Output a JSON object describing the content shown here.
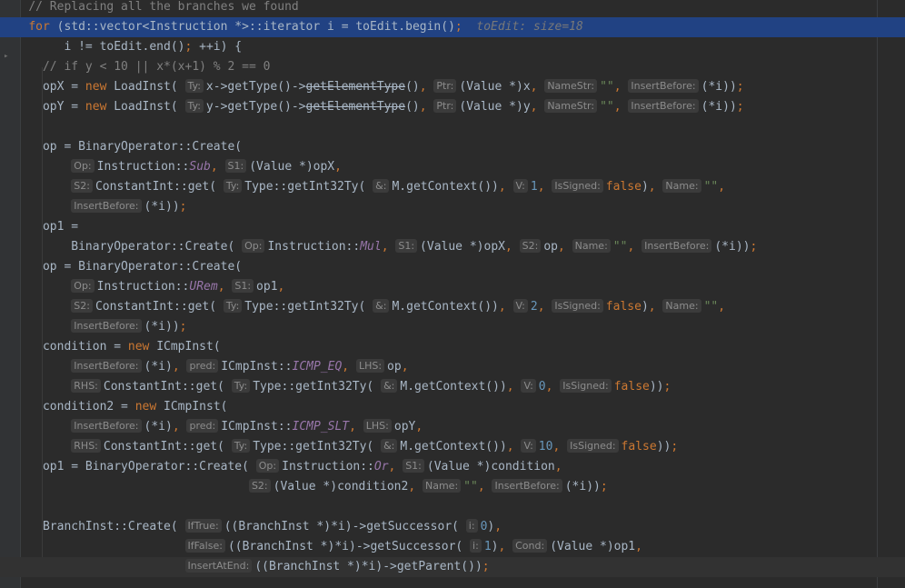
{
  "editor": {
    "lines": [
      [
        {
          "t": "    "
        },
        {
          "t": "// Replacing all the branches we found",
          "c": "c"
        }
      ],
      [
        {
          "t": "    "
        },
        {
          "t": "for",
          "c": "k"
        },
        {
          "t": " (std::vector<Instruction *>::iterator i = toEdit.begin()"
        },
        {
          "t": ";",
          "c": "k"
        },
        {
          "t": "  "
        },
        {
          "t": "toEdit: size=18",
          "c": "dbg"
        }
      ],
      [
        {
          "t": "         i != toEdit.end()"
        },
        {
          "t": ";",
          "c": "k"
        },
        {
          "t": " ++i) {"
        }
      ],
      [
        {
          "t": "      "
        },
        {
          "t": "// if y < 10 || x*(x+1) % 2 == 0",
          "c": "c"
        }
      ],
      [
        {
          "t": "      opX = "
        },
        {
          "t": "new",
          "c": "k"
        },
        {
          "t": " LoadInst( "
        },
        {
          "h": "Ty:"
        },
        {
          "t": "x->getType()->"
        },
        {
          "t": "getElementType",
          "c": "dep"
        },
        {
          "t": "()"
        },
        {
          "t": ", ",
          "c": "k"
        },
        {
          "h": "Ptr:"
        },
        {
          "t": "(Value *)x"
        },
        {
          "t": ", ",
          "c": "k"
        },
        {
          "h": "NameStr:"
        },
        {
          "t": "\"\"",
          "c": "s"
        },
        {
          "t": ", ",
          "c": "k"
        },
        {
          "h": "InsertBefore:"
        },
        {
          "t": "(*i))"
        },
        {
          "t": ";",
          "c": "k"
        }
      ],
      [
        {
          "t": "      opY = "
        },
        {
          "t": "new",
          "c": "k"
        },
        {
          "t": " LoadInst( "
        },
        {
          "h": "Ty:"
        },
        {
          "t": "y->getType()->"
        },
        {
          "t": "getElementType",
          "c": "dep"
        },
        {
          "t": "()"
        },
        {
          "t": ", ",
          "c": "k"
        },
        {
          "h": "Ptr:"
        },
        {
          "t": "(Value *)y"
        },
        {
          "t": ", ",
          "c": "k"
        },
        {
          "h": "NameStr:"
        },
        {
          "t": "\"\"",
          "c": "s"
        },
        {
          "t": ", ",
          "c": "k"
        },
        {
          "h": "InsertBefore:"
        },
        {
          "t": "(*i))"
        },
        {
          "t": ";",
          "c": "k"
        }
      ],
      [],
      [
        {
          "t": "      op = BinaryOperator::Create("
        }
      ],
      [
        {
          "t": "          "
        },
        {
          "h": "Op:"
        },
        {
          "t": "Instruction::"
        },
        {
          "t": "Sub",
          "c": "em"
        },
        {
          "t": ", ",
          "c": "k"
        },
        {
          "h": "S1:"
        },
        {
          "t": "(Value *)opX"
        },
        {
          "t": ",",
          "c": "k"
        }
      ],
      [
        {
          "t": "          "
        },
        {
          "h": "S2:"
        },
        {
          "t": "ConstantInt::get( "
        },
        {
          "h": "Ty:"
        },
        {
          "t": "Type::getInt32Ty( "
        },
        {
          "h": "&:"
        },
        {
          "t": "M.getContext())"
        },
        {
          "t": ", ",
          "c": "k"
        },
        {
          "h": "V:"
        },
        {
          "t": "1",
          "c": "n"
        },
        {
          "t": ", ",
          "c": "k"
        },
        {
          "h": "IsSigned:"
        },
        {
          "t": "false",
          "c": "k"
        },
        {
          "t": ")"
        },
        {
          "t": ", ",
          "c": "k"
        },
        {
          "h": "Name:"
        },
        {
          "t": "\"\"",
          "c": "s"
        },
        {
          "t": ",",
          "c": "k"
        }
      ],
      [
        {
          "t": "          "
        },
        {
          "h": "InsertBefore:"
        },
        {
          "t": "(*i))"
        },
        {
          "t": ";",
          "c": "k"
        }
      ],
      [
        {
          "t": "      op1 ="
        }
      ],
      [
        {
          "t": "          BinaryOperator::Create( "
        },
        {
          "h": "Op:"
        },
        {
          "t": "Instruction::"
        },
        {
          "t": "Mul",
          "c": "em"
        },
        {
          "t": ", ",
          "c": "k"
        },
        {
          "h": "S1:"
        },
        {
          "t": "(Value *)opX"
        },
        {
          "t": ", ",
          "c": "k"
        },
        {
          "h": "S2:"
        },
        {
          "t": "op"
        },
        {
          "t": ", ",
          "c": "k"
        },
        {
          "h": "Name:"
        },
        {
          "t": "\"\"",
          "c": "s"
        },
        {
          "t": ", ",
          "c": "k"
        },
        {
          "h": "InsertBefore:"
        },
        {
          "t": "(*i))"
        },
        {
          "t": ";",
          "c": "k"
        }
      ],
      [
        {
          "t": "      op = BinaryOperator::Create("
        }
      ],
      [
        {
          "t": "          "
        },
        {
          "h": "Op:"
        },
        {
          "t": "Instruction::"
        },
        {
          "t": "URem",
          "c": "em"
        },
        {
          "t": ", ",
          "c": "k"
        },
        {
          "h": "S1:"
        },
        {
          "t": "op1"
        },
        {
          "t": ",",
          "c": "k"
        }
      ],
      [
        {
          "t": "          "
        },
        {
          "h": "S2:"
        },
        {
          "t": "ConstantInt::get( "
        },
        {
          "h": "Ty:"
        },
        {
          "t": "Type::getInt32Ty( "
        },
        {
          "h": "&:"
        },
        {
          "t": "M.getContext())"
        },
        {
          "t": ", ",
          "c": "k"
        },
        {
          "h": "V:"
        },
        {
          "t": "2",
          "c": "n"
        },
        {
          "t": ", ",
          "c": "k"
        },
        {
          "h": "IsSigned:"
        },
        {
          "t": "false",
          "c": "k"
        },
        {
          "t": ")"
        },
        {
          "t": ", ",
          "c": "k"
        },
        {
          "h": "Name:"
        },
        {
          "t": "\"\"",
          "c": "s"
        },
        {
          "t": ",",
          "c": "k"
        }
      ],
      [
        {
          "t": "          "
        },
        {
          "h": "InsertBefore:"
        },
        {
          "t": "(*i))"
        },
        {
          "t": ";",
          "c": "k"
        }
      ],
      [
        {
          "t": "      condition = "
        },
        {
          "t": "new",
          "c": "k"
        },
        {
          "t": " ICmpInst("
        }
      ],
      [
        {
          "t": "          "
        },
        {
          "h": "InsertBefore:"
        },
        {
          "t": "(*i)"
        },
        {
          "t": ", ",
          "c": "k"
        },
        {
          "h": "pred:"
        },
        {
          "t": "ICmpInst::"
        },
        {
          "t": "ICMP_EQ",
          "c": "em"
        },
        {
          "t": ", ",
          "c": "k"
        },
        {
          "h": "LHS:"
        },
        {
          "t": "op"
        },
        {
          "t": ",",
          "c": "k"
        }
      ],
      [
        {
          "t": "          "
        },
        {
          "h": "RHS:"
        },
        {
          "t": "ConstantInt::get( "
        },
        {
          "h": "Ty:"
        },
        {
          "t": "Type::getInt32Ty( "
        },
        {
          "h": "&:"
        },
        {
          "t": "M.getContext())"
        },
        {
          "t": ", ",
          "c": "k"
        },
        {
          "h": "V:"
        },
        {
          "t": "0",
          "c": "n"
        },
        {
          "t": ", ",
          "c": "k"
        },
        {
          "h": "IsSigned:"
        },
        {
          "t": "false",
          "c": "k"
        },
        {
          "t": "))"
        },
        {
          "t": ";",
          "c": "k"
        }
      ],
      [
        {
          "t": "      condition2 = "
        },
        {
          "t": "new",
          "c": "k"
        },
        {
          "t": " ICmpInst("
        }
      ],
      [
        {
          "t": "          "
        },
        {
          "h": "InsertBefore:"
        },
        {
          "t": "(*i)"
        },
        {
          "t": ", ",
          "c": "k"
        },
        {
          "h": "pred:"
        },
        {
          "t": "ICmpInst::"
        },
        {
          "t": "ICMP_SLT",
          "c": "em"
        },
        {
          "t": ", ",
          "c": "k"
        },
        {
          "h": "LHS:"
        },
        {
          "t": "opY"
        },
        {
          "t": ",",
          "c": "k"
        }
      ],
      [
        {
          "t": "          "
        },
        {
          "h": "RHS:"
        },
        {
          "t": "ConstantInt::get( "
        },
        {
          "h": "Ty:"
        },
        {
          "t": "Type::getInt32Ty( "
        },
        {
          "h": "&:"
        },
        {
          "t": "M.getContext())"
        },
        {
          "t": ", ",
          "c": "k"
        },
        {
          "h": "V:"
        },
        {
          "t": "10",
          "c": "n"
        },
        {
          "t": ", ",
          "c": "k"
        },
        {
          "h": "IsSigned:"
        },
        {
          "t": "false",
          "c": "k"
        },
        {
          "t": "))"
        },
        {
          "t": ";",
          "c": "k"
        }
      ],
      [
        {
          "t": "      op1 = BinaryOperator::Create( "
        },
        {
          "h": "Op:"
        },
        {
          "t": "Instruction::"
        },
        {
          "t": "Or",
          "c": "em"
        },
        {
          "t": ", ",
          "c": "k"
        },
        {
          "h": "S1:"
        },
        {
          "t": "(Value *)condition"
        },
        {
          "t": ",",
          "c": "k"
        }
      ],
      [
        {
          "t": "                                   "
        },
        {
          "h": "S2:"
        },
        {
          "t": "(Value *)condition2"
        },
        {
          "t": ", ",
          "c": "k"
        },
        {
          "h": "Name:"
        },
        {
          "t": "\"\"",
          "c": "s"
        },
        {
          "t": ", ",
          "c": "k"
        },
        {
          "h": "InsertBefore:"
        },
        {
          "t": "(*i))"
        },
        {
          "t": ";",
          "c": "k"
        }
      ],
      [],
      [
        {
          "t": "      BranchInst::Create( "
        },
        {
          "h": "IfTrue:"
        },
        {
          "t": "((BranchInst *)*i)->getSuccessor( "
        },
        {
          "h": "i:"
        },
        {
          "t": "0",
          "c": "n"
        },
        {
          "t": ")"
        },
        {
          "t": ",",
          "c": "k"
        }
      ],
      [
        {
          "t": "                          "
        },
        {
          "h": "IfFalse:"
        },
        {
          "t": "((BranchInst *)*i)->getSuccessor( "
        },
        {
          "h": "i:"
        },
        {
          "t": "1",
          "c": "n"
        },
        {
          "t": ")"
        },
        {
          "t": ", ",
          "c": "k"
        },
        {
          "h": "Cond:"
        },
        {
          "t": "(Value *)op1"
        },
        {
          "t": ",",
          "c": "k"
        }
      ],
      [
        {
          "t": "                          "
        },
        {
          "h": "InsertAtEnd:"
        },
        {
          "t": "((BranchInst *)*i)->getParent())"
        },
        {
          "t": ";",
          "c": "k"
        }
      ]
    ]
  }
}
